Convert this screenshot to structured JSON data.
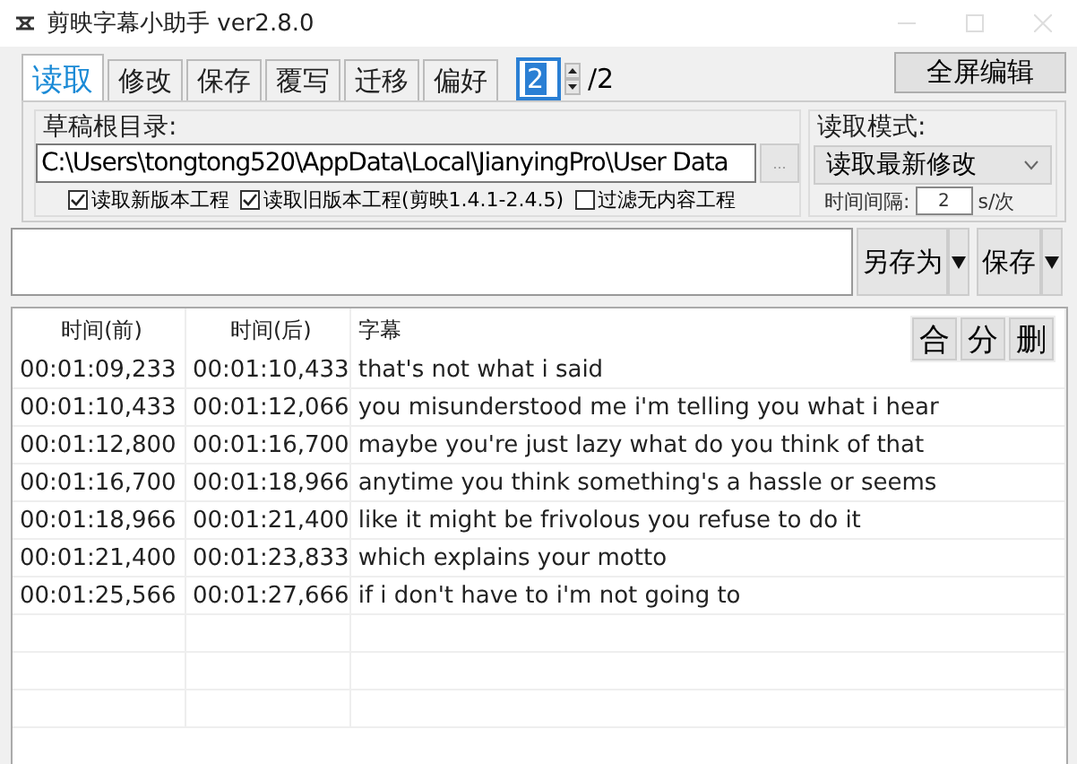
{
  "window": {
    "title": "剪映字幕小助手 ver2.8.0"
  },
  "tabs": [
    {
      "label": "读取",
      "selected": true
    },
    {
      "label": "修改",
      "selected": false
    },
    {
      "label": "保存",
      "selected": false
    },
    {
      "label": "覆写",
      "selected": false
    },
    {
      "label": "迁移",
      "selected": false
    },
    {
      "label": "偏好",
      "selected": false
    }
  ],
  "page": {
    "value": "2",
    "total": "/2"
  },
  "fullscreen_button": "全屏编辑",
  "root_dir": {
    "label": "草稿根目录:",
    "value": "C:\\Users\\tongtong520\\AppData\\Local\\JianyingPro\\User Data",
    "browse": "..."
  },
  "options": [
    {
      "label": "读取新版本工程",
      "checked": true
    },
    {
      "label": "读取旧版本工程(剪映1.4.1-2.4.5)",
      "checked": true
    },
    {
      "label": "过滤无内容工程",
      "checked": false
    }
  ],
  "read_mode": {
    "label": "读取模式:",
    "value": "读取最新修改",
    "interval_label": "时间间隔:",
    "interval": "2",
    "unit": "s/次"
  },
  "save_buttons": [
    "另存为",
    "保存"
  ],
  "table": {
    "columns": [
      "时间(前)",
      "时间(后)",
      "字幕"
    ],
    "rows": [
      [
        "00:01:09,233",
        "00:01:10,433",
        "that's not what i said"
      ],
      [
        "00:01:10,433",
        "00:01:12,066",
        "you misunderstood me i'm telling you what i hear"
      ],
      [
        "00:01:12,800",
        "00:01:16,700",
        "maybe you're just lazy what do you think of that"
      ],
      [
        "00:01:16,700",
        "00:01:18,966",
        "anytime you think something's a hassle or seems"
      ],
      [
        "00:01:18,966",
        "00:01:21,400",
        "like it might be frivolous you refuse to do it"
      ],
      [
        "00:01:21,400",
        "00:01:23,833",
        "which explains your motto"
      ],
      [
        "00:01:25,566",
        "00:01:27,666",
        "if i don't have to i'm not going to"
      ]
    ],
    "actions": [
      "合",
      "分",
      "删"
    ]
  }
}
